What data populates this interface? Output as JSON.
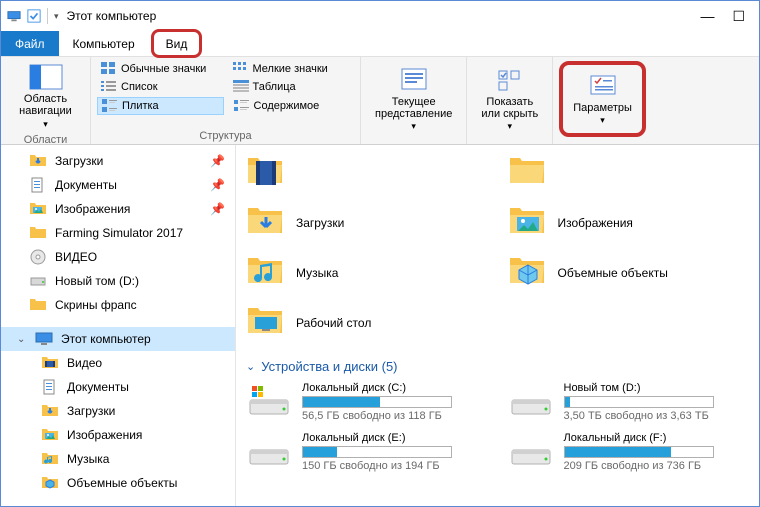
{
  "title": "Этот компьютер",
  "tabs": {
    "file": "Файл",
    "computer": "Компьютер",
    "view": "Вид"
  },
  "ribbon": {
    "region": {
      "label": "Область\nнавигации",
      "group": "Области"
    },
    "layout": {
      "r1c1": "Обычные значки",
      "r1c2": "Мелкие значки",
      "r2c1": "Список",
      "r2c2": "Таблица",
      "r3c1": "Плитка",
      "r3c2": "Содержимое",
      "group": "Структура"
    },
    "currentview": "Текущее\nпредставление",
    "showhide": "Показать\nили скрыть",
    "options": "Параметры"
  },
  "sidebar": {
    "items": [
      {
        "label": "Загрузки",
        "icon": "downloads",
        "pin": true
      },
      {
        "label": "Документы",
        "icon": "documents",
        "pin": true
      },
      {
        "label": "Изображения",
        "icon": "pictures",
        "pin": true
      },
      {
        "label": "Farming Simulator 2017",
        "icon": "folder"
      },
      {
        "label": "ВИДЕО",
        "icon": "disc"
      },
      {
        "label": "Новый том (D:)",
        "icon": "drive"
      },
      {
        "label": "Скрины фрапс",
        "icon": "folder"
      }
    ],
    "thispc": {
      "label": "Этот компьютер",
      "selected": true
    },
    "thispc_children": [
      {
        "label": "Видео",
        "icon": "video"
      },
      {
        "label": "Документы",
        "icon": "documents"
      },
      {
        "label": "Загрузки",
        "icon": "downloads"
      },
      {
        "label": "Изображения",
        "icon": "pictures"
      },
      {
        "label": "Музыка",
        "icon": "music"
      },
      {
        "label": "Объемные объекты",
        "icon": "objects3d"
      }
    ]
  },
  "folders": [
    {
      "label": "",
      "icon": "video"
    },
    {
      "label": "",
      "icon": "folder"
    },
    {
      "label": "Загрузки",
      "icon": "downloads"
    },
    {
      "label": "Изображения",
      "icon": "pictures"
    },
    {
      "label": "Музыка",
      "icon": "music"
    },
    {
      "label": "Объемные объекты",
      "icon": "objects3d"
    },
    {
      "label": "Рабочий стол",
      "icon": "desktop"
    }
  ],
  "section": {
    "title": "Устройства и диски (5)"
  },
  "drives": [
    {
      "name": "Локальный диск (C:)",
      "free": "56,5 ГБ свободно из 118 ГБ",
      "fill": 52,
      "os": true
    },
    {
      "name": "Новый том (D:)",
      "free": "3,50 ТБ свободно из 3,63 ТБ",
      "fill": 4
    },
    {
      "name": "Локальный диск (E:)",
      "free": "150 ГБ свободно из 194 ГБ",
      "fill": 23
    },
    {
      "name": "Локальный диск (F:)",
      "free": "209 ГБ свободно из 736 ГБ",
      "fill": 72
    }
  ]
}
